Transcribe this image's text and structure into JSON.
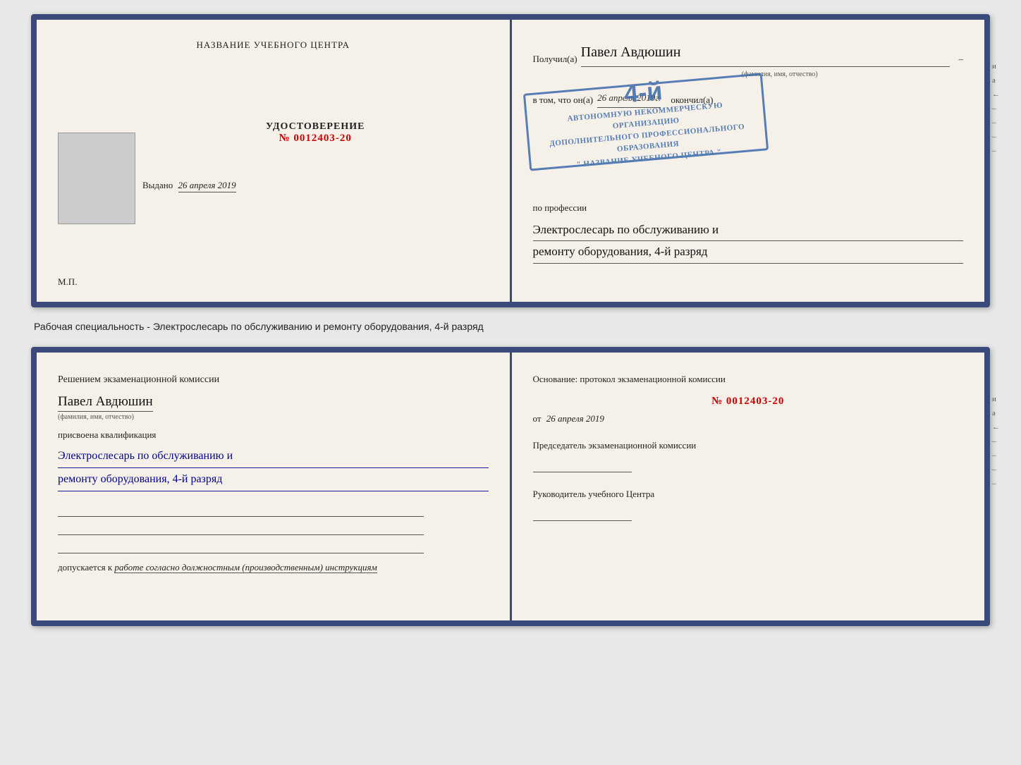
{
  "topBooklet": {
    "left": {
      "centerText": "НАЗВАНИЕ УЧЕБНОГО ЦЕНТРА",
      "photoAlt": "photo",
      "udostoverenie": "УДОСТОВЕРЕНИЕ",
      "number": "№ 0012403-20",
      "vydano": "Выдано",
      "vydanoDate": "26 апреля 2019",
      "mp": "М.П."
    },
    "right": {
      "poluchilLabel": "Получил(a)",
      "name": "Павел Авдюшин",
      "nameSubLabel": "(фамилия, имя, отчество)",
      "dashLabel": "–",
      "vtomLabel": "в том, что он(а)",
      "date": "26 апреля 2019г.",
      "okonchilLabel": "окончил(а)",
      "stampLine1": "АВТОНОМНУЮ НЕКОММЕРЧЕСКУЮ ОРГАНИЗАЦИЮ",
      "stampLine2": "ДОПОЛНИТЕЛЬНОГО ПРОФЕССИОНАЛЬНОГО ОБРАЗОВАНИЯ",
      "stampLine3": "\" НАЗВАНИЕ УЧЕБНОГО ЦЕНТРА \"",
      "stampNum": "4-й",
      "professiaLabel": "по профессии",
      "profLine1": "Электрослесарь по обслуживанию и",
      "profLine2": "ремонту оборудования, 4-й разряд"
    }
  },
  "separator": {
    "text": "Рабочая специальность - Электрослесарь по обслуживанию и ремонту оборудования, 4-й разряд"
  },
  "bottomBooklet": {
    "left": {
      "title": "Решением экзаменационной  комиссии",
      "name": "Павел Авдюшин",
      "nameSubLabel": "(фамилия, имя, отчество)",
      "prisvoena": "присвоена квалификация",
      "kvalLine1": "Электрослесарь по обслуживанию и",
      "kvalLine2": "ремонту оборудования, 4-й разряд",
      "dopuskaetsyaLabel": "допускается к",
      "dopuskaetsyaText": "работе согласно должностным (производственным) инструкциям"
    },
    "right": {
      "osnovTitle": "Основание: протокол экзаменационной  комиссии",
      "number": "№  0012403-20",
      "otLabel": "от",
      "date": "26 апреля 2019",
      "chairmanLabel": "Председатель экзаменационной комиссии",
      "rukovLabel": "Руководитель учебного Центра"
    }
  },
  "spineChars": [
    "и",
    "а",
    "←",
    "–",
    "–",
    "–",
    "–"
  ]
}
